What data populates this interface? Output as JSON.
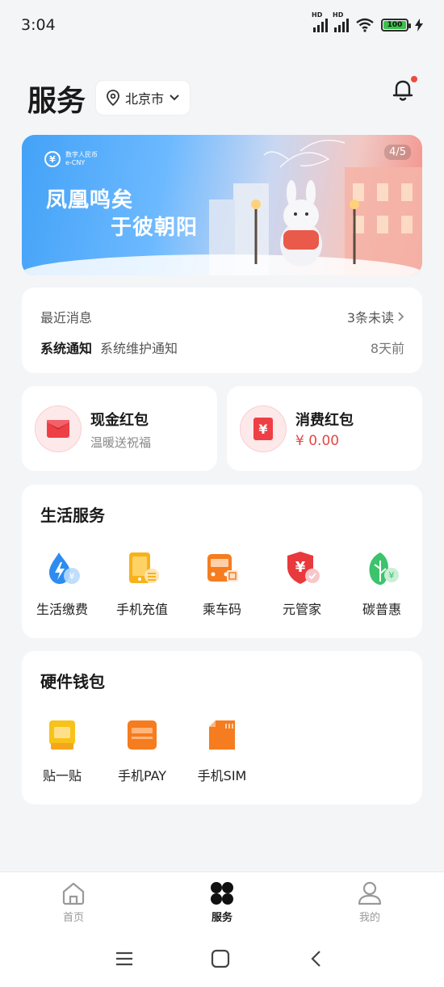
{
  "status_bar": {
    "time": "3:04",
    "network_1": "HD",
    "network_2": "HD",
    "battery": "100"
  },
  "header": {
    "title": "服务",
    "city": "北京市"
  },
  "banner": {
    "logo_line1": "数字人民币",
    "logo_line2": "e-CNY",
    "slogan_line1": "凤凰鸣矣",
    "slogan_line2": "于彼朝阳",
    "pager": "4/5"
  },
  "messages": {
    "label": "最近消息",
    "unread": "3条未读",
    "type": "系统通知",
    "text": "系统维护通知",
    "time": "8天前"
  },
  "redpacks": {
    "cash": {
      "title": "现金红包",
      "subtitle": "温暖送祝福"
    },
    "consume": {
      "title": "消费红包",
      "amount": "¥ 0.00"
    }
  },
  "life_services": {
    "title": "生活服务",
    "items": [
      {
        "label": "生活缴费",
        "icon": "water-bill-icon"
      },
      {
        "label": "手机充值",
        "icon": "phone-topup-icon"
      },
      {
        "label": "乘车码",
        "icon": "bus-code-icon"
      },
      {
        "label": "元管家",
        "icon": "yuan-shield-icon"
      },
      {
        "label": "碳普惠",
        "icon": "carbon-leaf-icon"
      }
    ]
  },
  "hardware_wallet": {
    "title": "硬件钱包",
    "items": [
      {
        "label": "贴一贴",
        "icon": "tap-card-icon"
      },
      {
        "label": "手机PAY",
        "icon": "phone-pay-icon"
      },
      {
        "label": "手机SIM",
        "icon": "sim-card-icon"
      }
    ]
  },
  "tabbar": {
    "tabs": [
      {
        "label": "首页",
        "icon": "home-icon"
      },
      {
        "label": "服务",
        "icon": "services-icon"
      },
      {
        "label": "我的",
        "icon": "profile-icon"
      }
    ],
    "active": "服务"
  },
  "colors": {
    "accent_red": "#e64545",
    "banner_blue": "#43a2f7",
    "background": "#f4f5f7"
  }
}
